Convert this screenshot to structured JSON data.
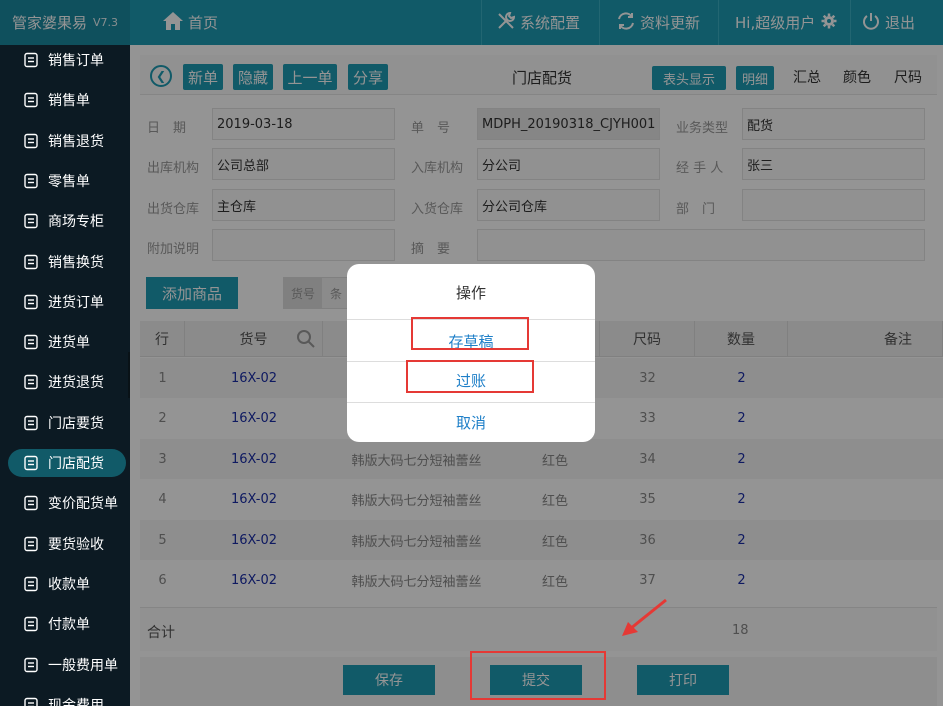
{
  "app": {
    "name": "管家婆果易",
    "version": "V7.3"
  },
  "topnav": {
    "home": "首页",
    "config": "系统配置",
    "update": "资料更新",
    "user": "Hi,超级用户",
    "logout": "退出"
  },
  "sidebar": {
    "items": [
      {
        "label": "销售订单",
        "icon": "clipboard-icon"
      },
      {
        "label": "销售单",
        "icon": "hand-icon"
      },
      {
        "label": "销售退货",
        "icon": "return-box-icon"
      },
      {
        "label": "零售单",
        "icon": "receipt-icon"
      },
      {
        "label": "商场专柜",
        "icon": "shopping-bag-icon"
      },
      {
        "label": "销售换货",
        "icon": "exchange-icon"
      },
      {
        "label": "进货订单",
        "icon": "order-icon"
      },
      {
        "label": "进货单",
        "icon": "inbound-icon"
      },
      {
        "label": "进货退货",
        "icon": "inbound-return-icon"
      },
      {
        "label": "门店要货",
        "icon": "store-icon"
      },
      {
        "label": "门店配货",
        "icon": "truck-icon"
      },
      {
        "label": "变价配货单",
        "icon": "price-tag-icon"
      },
      {
        "label": "要货验收",
        "icon": "inspect-icon"
      },
      {
        "label": "收款单",
        "icon": "yen-receipt-icon"
      },
      {
        "label": "付款单",
        "icon": "payment-icon"
      },
      {
        "label": "一般费用单",
        "icon": "yen-circle-icon"
      },
      {
        "label": "现金费用",
        "icon": "cash-icon"
      }
    ]
  },
  "toolbar": {
    "new": "新单",
    "hide": "隐藏",
    "prev": "上一单",
    "share": "分享",
    "title": "门店配货",
    "header_display": "表头显示",
    "detail": "明细",
    "summary": "汇总",
    "color": "颜色",
    "size": "尺码"
  },
  "form": {
    "date_label": "日　期",
    "date_value": "2019-03-18",
    "no_label": "单　号",
    "no_value": "MDPH_20190318_CJYH001",
    "type_label": "业务类型",
    "type_value": "配货",
    "out_org_label": "出库机构",
    "out_org_value": "公司总部",
    "in_org_label": "入库机构",
    "in_org_value": "分公司",
    "handler_label": "经 手 人",
    "handler_value": "张三",
    "out_wh_label": "出货仓库",
    "out_wh_value": "主仓库",
    "in_wh_label": "入货仓库",
    "in_wh_value": "分公司仓库",
    "dept_label": "部　门",
    "dept_value": "",
    "note_label": "附加说明",
    "note_value": "",
    "summary_label": "摘　要",
    "summary_value": ""
  },
  "add_item": {
    "button": "添加商品",
    "scan_tag": "货号",
    "scan_placeholder": "条"
  },
  "table": {
    "headers": {
      "row": "行",
      "code": "货号",
      "name": "",
      "color": "",
      "size": "尺码",
      "qty": "数量",
      "remark": "备注"
    },
    "rows": [
      {
        "row": "1",
        "code": "16X-02",
        "name": "",
        "color": "",
        "size": "32",
        "qty": "2"
      },
      {
        "row": "2",
        "code": "16X-02",
        "name": "",
        "color": "",
        "size": "33",
        "qty": "2"
      },
      {
        "row": "3",
        "code": "16X-02",
        "name": "韩版大码七分短袖蕾丝",
        "color": "红色",
        "size": "34",
        "qty": "2"
      },
      {
        "row": "4",
        "code": "16X-02",
        "name": "韩版大码七分短袖蕾丝",
        "color": "红色",
        "size": "35",
        "qty": "2"
      },
      {
        "row": "5",
        "code": "16X-02",
        "name": "韩版大码七分短袖蕾丝",
        "color": "红色",
        "size": "36",
        "qty": "2"
      },
      {
        "row": "6",
        "code": "16X-02",
        "name": "韩版大码七分短袖蕾丝",
        "color": "红色",
        "size": "37",
        "qty": "2"
      }
    ],
    "total_label": "合计",
    "total_qty": "18"
  },
  "footer": {
    "save": "保存",
    "submit": "提交",
    "print": "打印"
  },
  "dialog": {
    "title": "操作",
    "save_draft": "存草稿",
    "post": "过账",
    "cancel": "取消"
  },
  "colors": {
    "primary": "#1e9bb3",
    "sidebar": "#162d3d",
    "highlight": "#e53935",
    "link": "#1e7fc8"
  }
}
